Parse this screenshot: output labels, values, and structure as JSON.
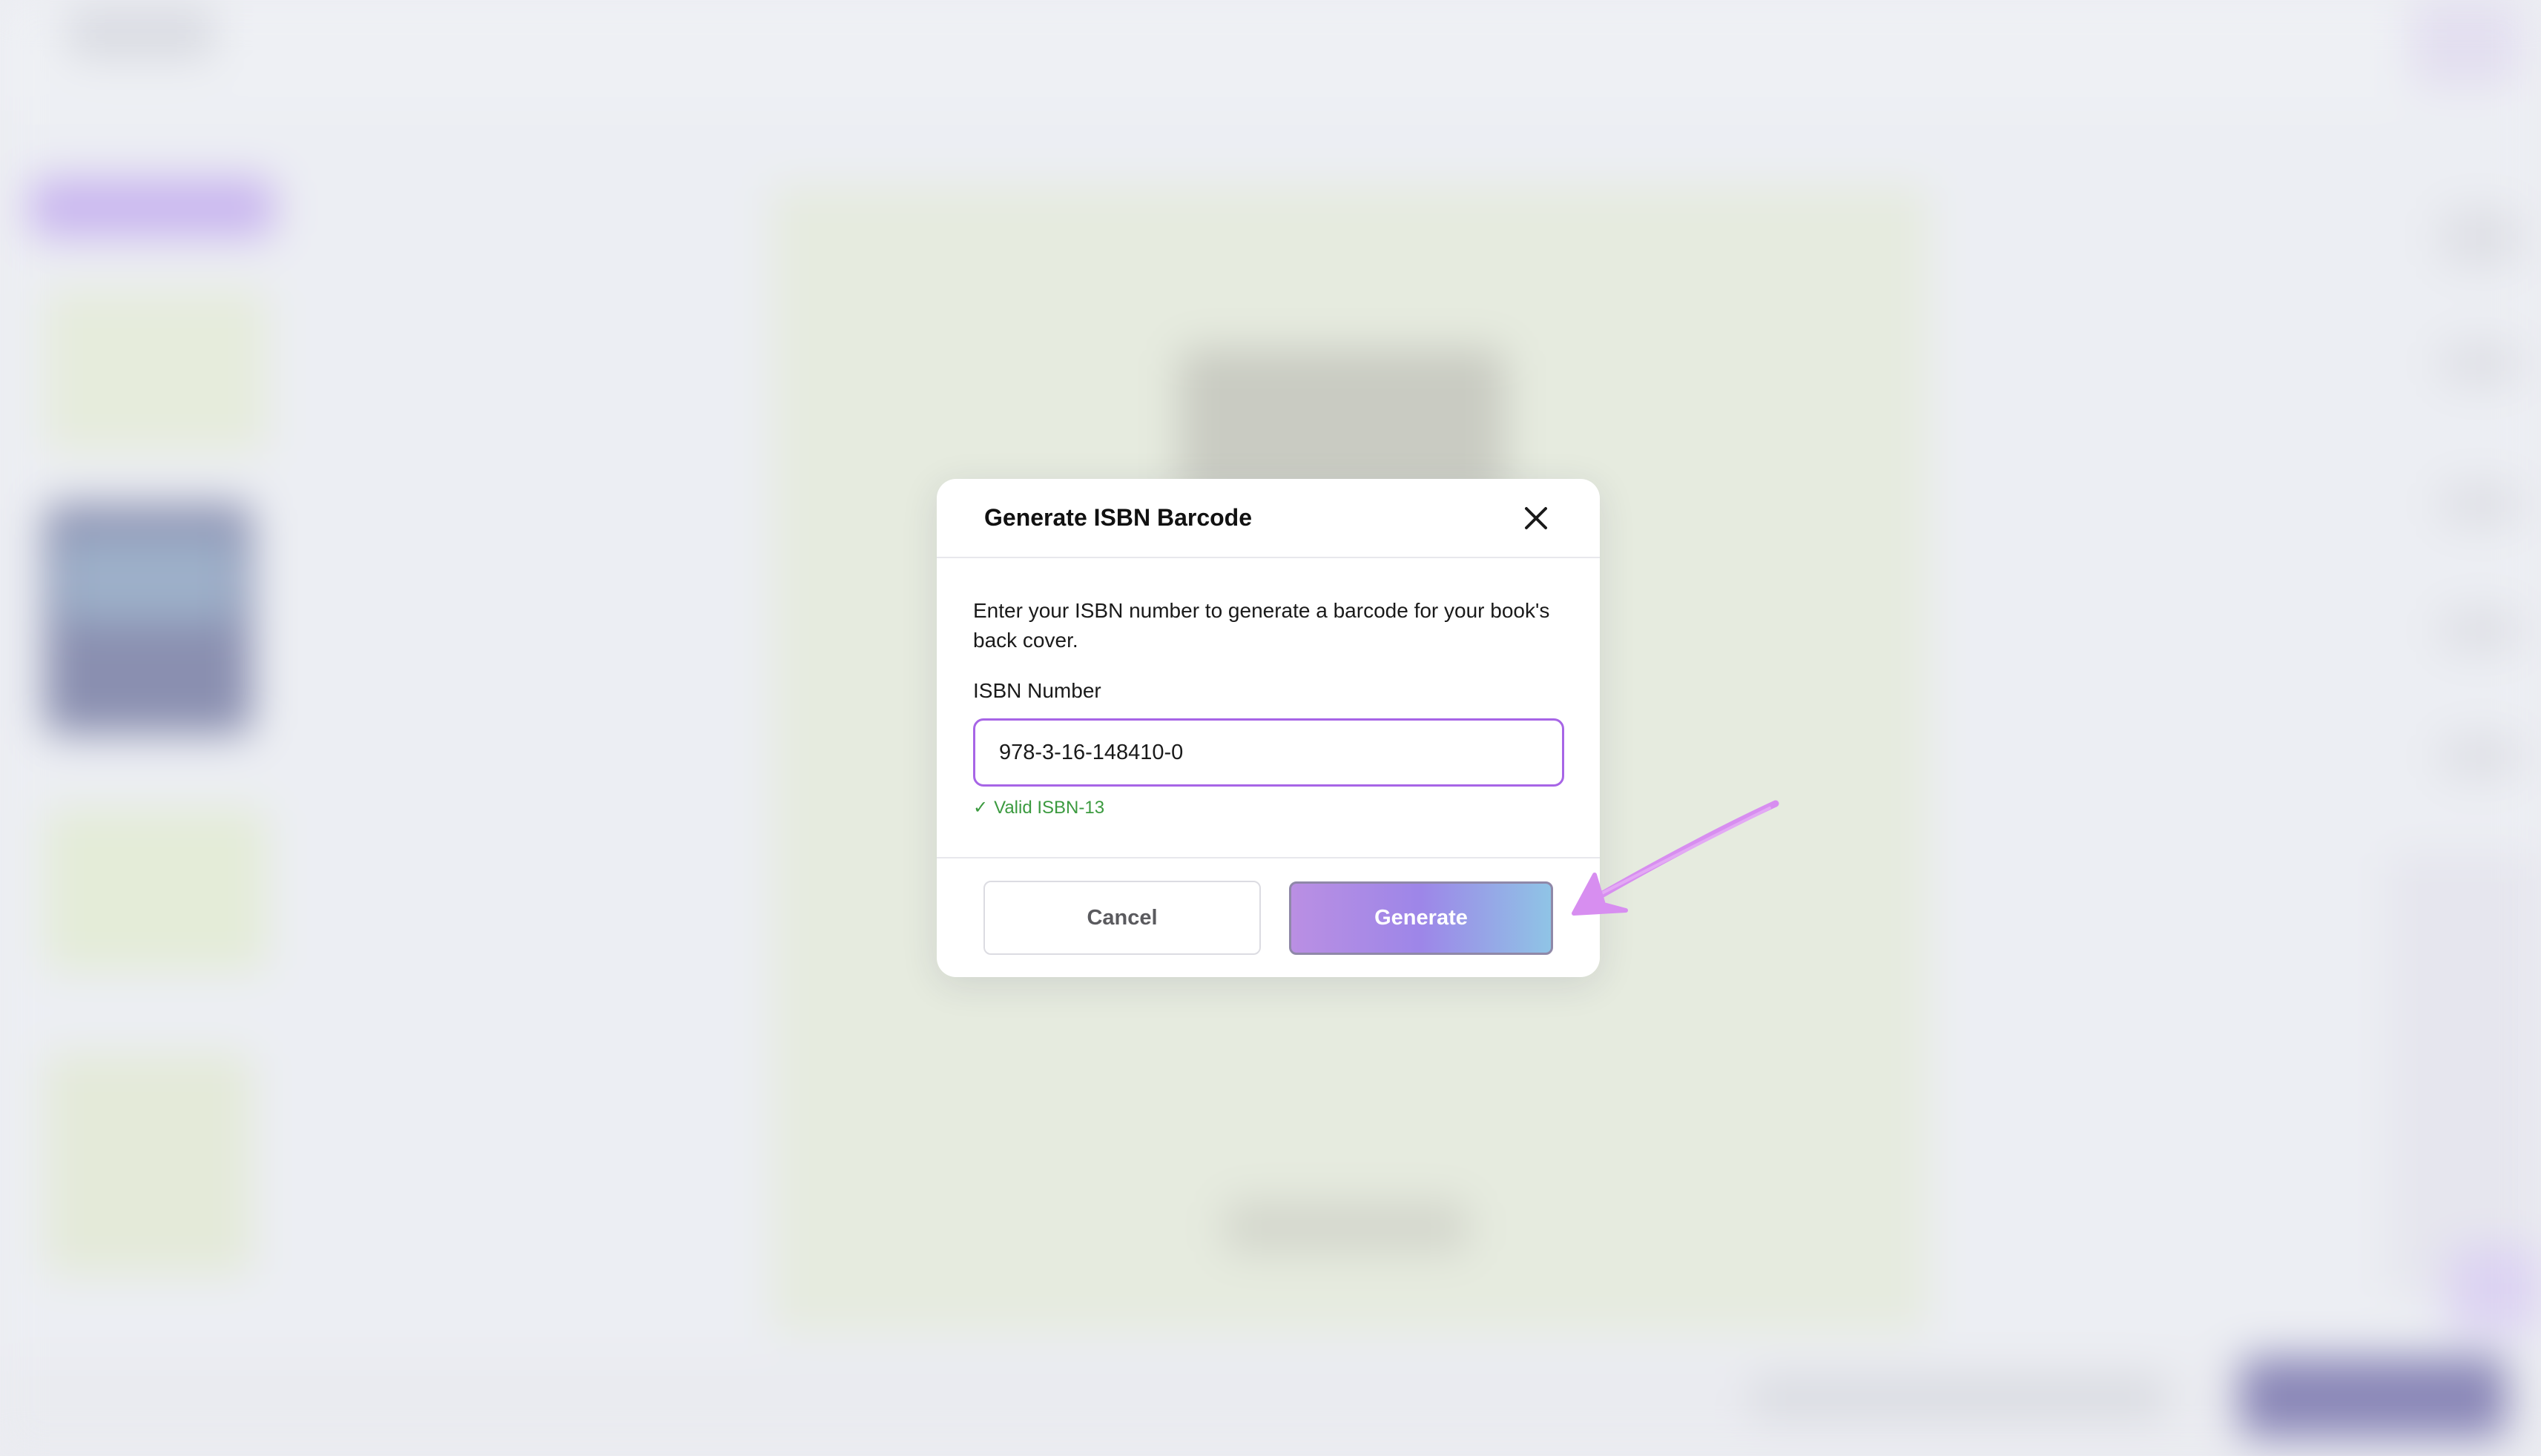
{
  "dialog": {
    "title": "Generate ISBN Barcode",
    "description": "Enter your ISBN number to generate a barcode for your book's back cover.",
    "field_label": "ISBN Number",
    "isbn_value": "978-3-16-148410-0",
    "validation_check": "✓",
    "validation_text": "Valid ISBN-13",
    "cancel_label": "Cancel",
    "generate_label": "Generate",
    "close_icon": "close-icon"
  },
  "annotation": {
    "icon": "arrow-icon",
    "color": "#d78ef0"
  },
  "colors": {
    "input_border": "#a765e6",
    "valid_text": "#3b9a3f",
    "generate_gradient_start": "#ba8fe3",
    "generate_gradient_end": "#8fc4e6"
  }
}
